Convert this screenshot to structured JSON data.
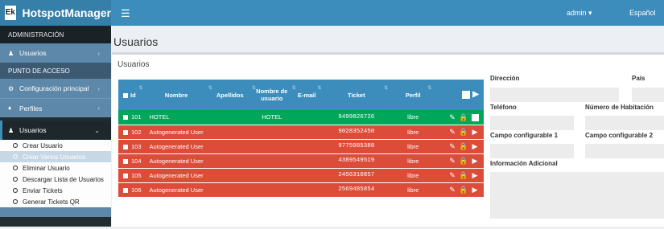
{
  "header": {
    "logo_mark": "Ek",
    "brand_normal": "Hotspot",
    "brand_bold": "Manager",
    "menu_icon": "hamburger-icon",
    "user": "admin",
    "language": "Español"
  },
  "sidebar": {
    "section_admin": "ADMINISTRACIÓN",
    "item_usuarios": "Usuarios",
    "section_hotspot": "PUNTO DE ACCESO",
    "item_config": "Configuración principal",
    "item_perfiles": "Perfiles",
    "item_usuarios_open": "Usuarios",
    "sub": [
      "Crear Usuario",
      "Crear Varios Usuarios",
      "Eliminar Usuario",
      "Descargar Lista de Usuarios",
      "Enviar Tickets",
      "Generar Tickets QR"
    ]
  },
  "page": {
    "title": "Usuarios",
    "box_title": "Usuarios"
  },
  "table": {
    "headers": [
      "Id",
      "Nombre",
      "Apellidos",
      "Nombre de usuario",
      "E-mail",
      "Ticket",
      "Perfil"
    ],
    "rows": [
      {
        "id": "101",
        "name": "HOTEL",
        "surname": "",
        "username": "HOTEL",
        "email": "",
        "ticket": "9499826726",
        "profile": "libre",
        "color": "#00a65a"
      },
      {
        "id": "102",
        "name": "Autogenerated User",
        "surname": "",
        "username": "",
        "email": "",
        "ticket": "9028352450",
        "profile": "libre",
        "color": "#dd4b39"
      },
      {
        "id": "103",
        "name": "Autogenerated User",
        "surname": "",
        "username": "",
        "email": "",
        "ticket": "9775985388",
        "profile": "libre",
        "color": "#dd4b39"
      },
      {
        "id": "104",
        "name": "Autogenerated User",
        "surname": "",
        "username": "",
        "email": "",
        "ticket": "4389549519",
        "profile": "libre",
        "color": "#dd4b39"
      },
      {
        "id": "105",
        "name": "Autogenerated User",
        "surname": "",
        "username": "",
        "email": "",
        "ticket": "2456310857",
        "profile": "libre",
        "color": "#dd4b39"
      },
      {
        "id": "106",
        "name": "Autogenerated User",
        "surname": "",
        "username": "",
        "email": "",
        "ticket": "2569485854",
        "profile": "libre",
        "color": "#dd4b39"
      }
    ]
  },
  "form": {
    "direccion": "Dirección",
    "pais": "País",
    "telefono": "Teléfono",
    "habitacion": "Número de Habitación",
    "campo1": "Campo configurable 1",
    "campo2": "Campo configurable 2",
    "info": "Información Adicional"
  }
}
